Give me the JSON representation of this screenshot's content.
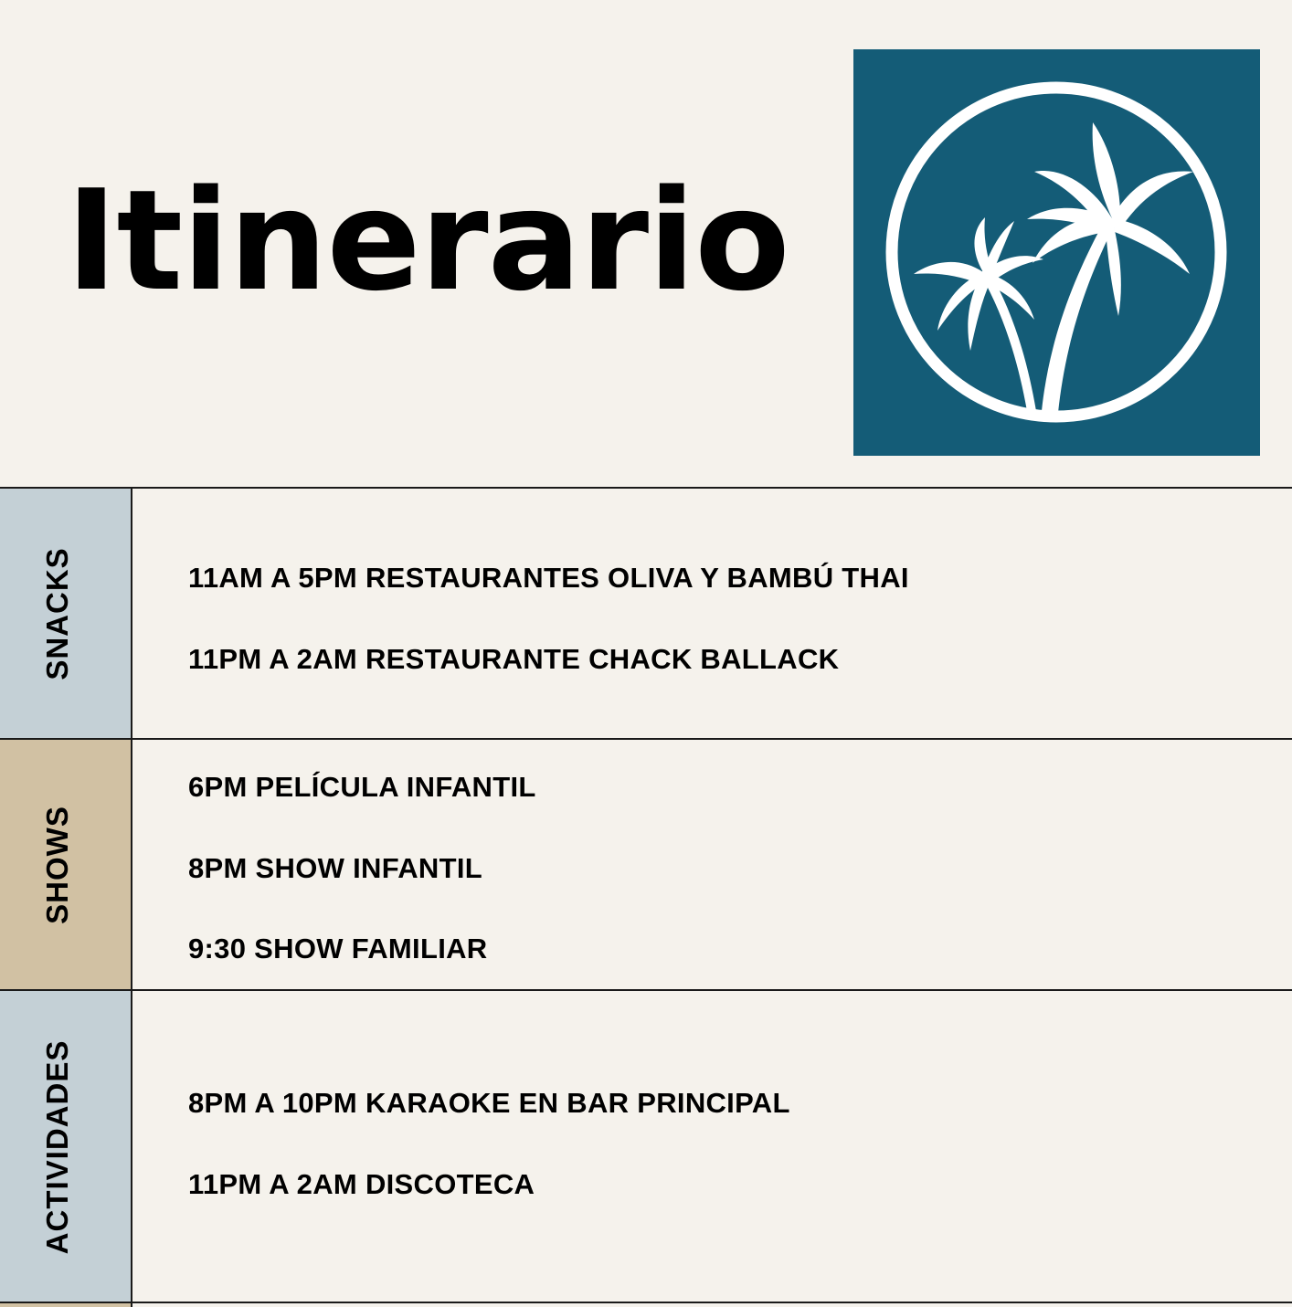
{
  "title": "Itinerario",
  "logo": {
    "icon": "palm-trees-icon",
    "background_color": "#145c77",
    "foreground_color": "#ffffff"
  },
  "colors": {
    "page_background": "#f5f2ec",
    "category_blue": "#c4d0d6",
    "category_tan": "#d1c1a3"
  },
  "sections": [
    {
      "label": "SNACKS",
      "items": [
        "11AM A 5PM RESTAURANTES OLIVA Y BAMBÚ THAI",
        "11PM A 2AM RESTAURANTE CHACK BALLACK"
      ]
    },
    {
      "label": "SHOWS",
      "items": [
        "6PM PELÍCULA INFANTIL",
        "8PM SHOW INFANTIL",
        "9:30 SHOW FAMILIAR"
      ]
    },
    {
      "label": "ACTIVIDADES",
      "items": [
        "8PM A 10PM KARAOKE EN BAR PRINCIPAL",
        "11PM A 2AM DISCOTECA"
      ]
    }
  ]
}
